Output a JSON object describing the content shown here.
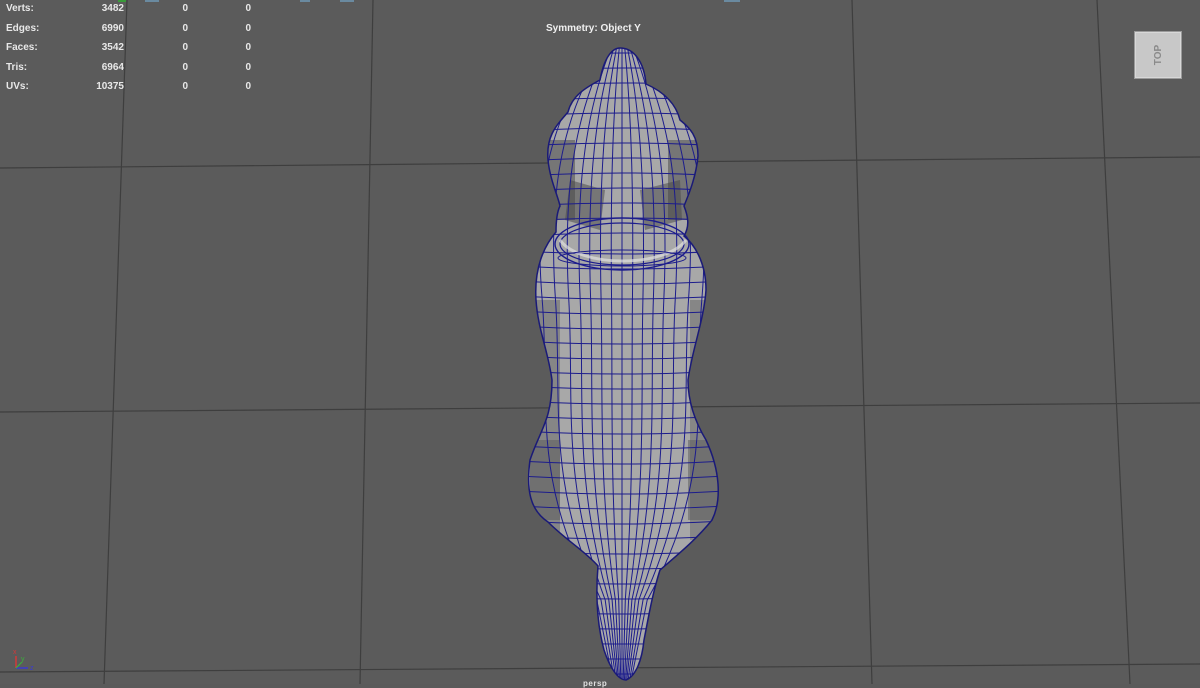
{
  "stats": {
    "rows": [
      {
        "label": "Verts:",
        "values": [
          "3482",
          "0",
          "0"
        ]
      },
      {
        "label": "Edges:",
        "values": [
          "6990",
          "0",
          "0"
        ]
      },
      {
        "label": "Faces:",
        "values": [
          "3542",
          "0",
          "0"
        ]
      },
      {
        "label": "Tris:",
        "values": [
          "6964",
          "0",
          "0"
        ]
      },
      {
        "label": "UVs:",
        "values": [
          "10375",
          "0",
          "0"
        ]
      }
    ]
  },
  "viewport": {
    "symmetry_label": "Symmetry: Object Y",
    "viewcube_label": "TOP",
    "camera_label": "persp",
    "background_color": "#5b5b5b",
    "grid_color": "#3c3c3c",
    "wireframe_color": "#1c1c8c",
    "mesh_color": "#a9a9a9"
  },
  "axis": {
    "x_label": "x",
    "y_label": "y",
    "z_label": "z"
  },
  "icons": {
    "viewcube": "view-cube-icon",
    "axis": "axis-gizmo-icon"
  }
}
